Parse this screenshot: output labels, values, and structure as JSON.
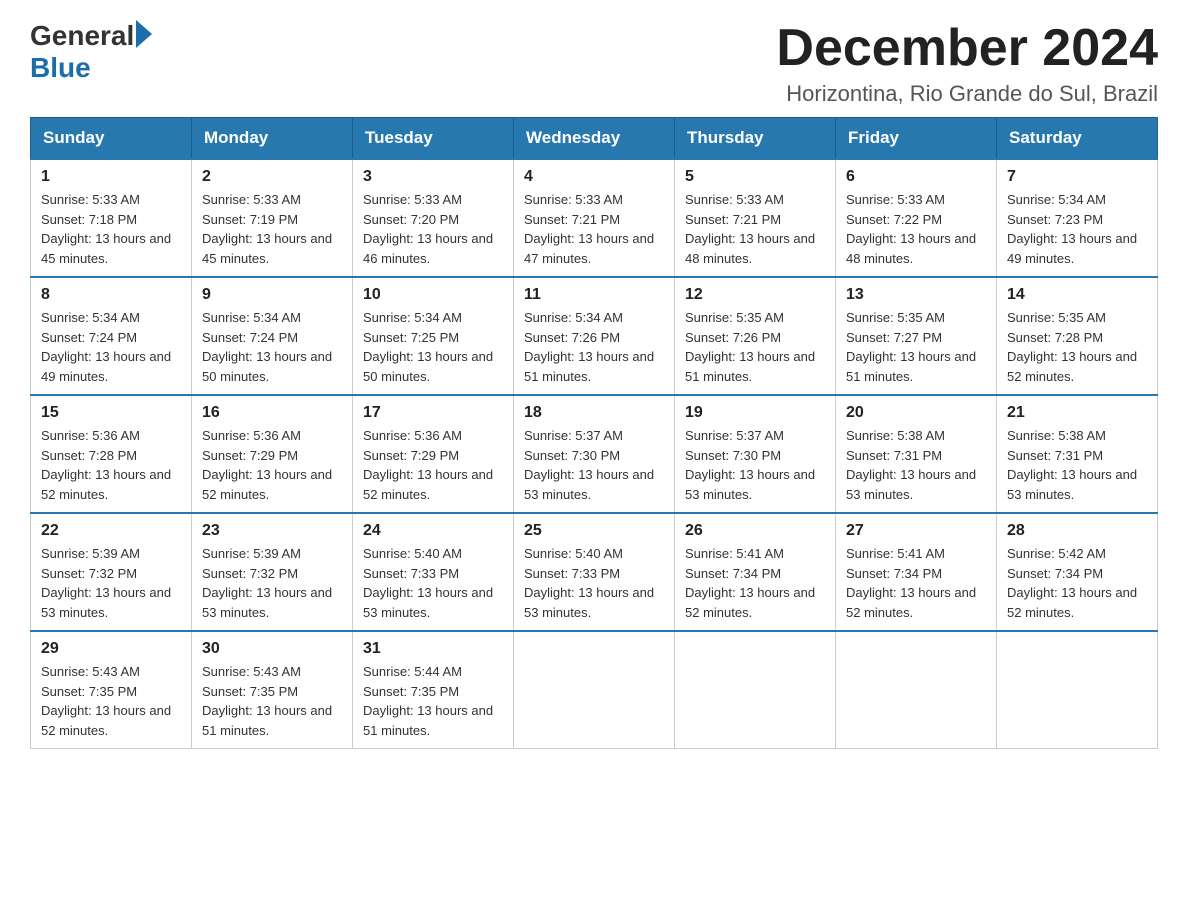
{
  "header": {
    "logo": {
      "general": "General",
      "blue": "Blue"
    },
    "title": "December 2024",
    "subtitle": "Horizontina, Rio Grande do Sul, Brazil"
  },
  "calendar": {
    "weekdays": [
      "Sunday",
      "Monday",
      "Tuesday",
      "Wednesday",
      "Thursday",
      "Friday",
      "Saturday"
    ],
    "weeks": [
      [
        {
          "day": "1",
          "sunrise": "5:33 AM",
          "sunset": "7:18 PM",
          "daylight": "13 hours and 45 minutes."
        },
        {
          "day": "2",
          "sunrise": "5:33 AM",
          "sunset": "7:19 PM",
          "daylight": "13 hours and 45 minutes."
        },
        {
          "day": "3",
          "sunrise": "5:33 AM",
          "sunset": "7:20 PM",
          "daylight": "13 hours and 46 minutes."
        },
        {
          "day": "4",
          "sunrise": "5:33 AM",
          "sunset": "7:21 PM",
          "daylight": "13 hours and 47 minutes."
        },
        {
          "day": "5",
          "sunrise": "5:33 AM",
          "sunset": "7:21 PM",
          "daylight": "13 hours and 48 minutes."
        },
        {
          "day": "6",
          "sunrise": "5:33 AM",
          "sunset": "7:22 PM",
          "daylight": "13 hours and 48 minutes."
        },
        {
          "day": "7",
          "sunrise": "5:34 AM",
          "sunset": "7:23 PM",
          "daylight": "13 hours and 49 minutes."
        }
      ],
      [
        {
          "day": "8",
          "sunrise": "5:34 AM",
          "sunset": "7:24 PM",
          "daylight": "13 hours and 49 minutes."
        },
        {
          "day": "9",
          "sunrise": "5:34 AM",
          "sunset": "7:24 PM",
          "daylight": "13 hours and 50 minutes."
        },
        {
          "day": "10",
          "sunrise": "5:34 AM",
          "sunset": "7:25 PM",
          "daylight": "13 hours and 50 minutes."
        },
        {
          "day": "11",
          "sunrise": "5:34 AM",
          "sunset": "7:26 PM",
          "daylight": "13 hours and 51 minutes."
        },
        {
          "day": "12",
          "sunrise": "5:35 AM",
          "sunset": "7:26 PM",
          "daylight": "13 hours and 51 minutes."
        },
        {
          "day": "13",
          "sunrise": "5:35 AM",
          "sunset": "7:27 PM",
          "daylight": "13 hours and 51 minutes."
        },
        {
          "day": "14",
          "sunrise": "5:35 AM",
          "sunset": "7:28 PM",
          "daylight": "13 hours and 52 minutes."
        }
      ],
      [
        {
          "day": "15",
          "sunrise": "5:36 AM",
          "sunset": "7:28 PM",
          "daylight": "13 hours and 52 minutes."
        },
        {
          "day": "16",
          "sunrise": "5:36 AM",
          "sunset": "7:29 PM",
          "daylight": "13 hours and 52 minutes."
        },
        {
          "day": "17",
          "sunrise": "5:36 AM",
          "sunset": "7:29 PM",
          "daylight": "13 hours and 52 minutes."
        },
        {
          "day": "18",
          "sunrise": "5:37 AM",
          "sunset": "7:30 PM",
          "daylight": "13 hours and 53 minutes."
        },
        {
          "day": "19",
          "sunrise": "5:37 AM",
          "sunset": "7:30 PM",
          "daylight": "13 hours and 53 minutes."
        },
        {
          "day": "20",
          "sunrise": "5:38 AM",
          "sunset": "7:31 PM",
          "daylight": "13 hours and 53 minutes."
        },
        {
          "day": "21",
          "sunrise": "5:38 AM",
          "sunset": "7:31 PM",
          "daylight": "13 hours and 53 minutes."
        }
      ],
      [
        {
          "day": "22",
          "sunrise": "5:39 AM",
          "sunset": "7:32 PM",
          "daylight": "13 hours and 53 minutes."
        },
        {
          "day": "23",
          "sunrise": "5:39 AM",
          "sunset": "7:32 PM",
          "daylight": "13 hours and 53 minutes."
        },
        {
          "day": "24",
          "sunrise": "5:40 AM",
          "sunset": "7:33 PM",
          "daylight": "13 hours and 53 minutes."
        },
        {
          "day": "25",
          "sunrise": "5:40 AM",
          "sunset": "7:33 PM",
          "daylight": "13 hours and 53 minutes."
        },
        {
          "day": "26",
          "sunrise": "5:41 AM",
          "sunset": "7:34 PM",
          "daylight": "13 hours and 52 minutes."
        },
        {
          "day": "27",
          "sunrise": "5:41 AM",
          "sunset": "7:34 PM",
          "daylight": "13 hours and 52 minutes."
        },
        {
          "day": "28",
          "sunrise": "5:42 AM",
          "sunset": "7:34 PM",
          "daylight": "13 hours and 52 minutes."
        }
      ],
      [
        {
          "day": "29",
          "sunrise": "5:43 AM",
          "sunset": "7:35 PM",
          "daylight": "13 hours and 52 minutes."
        },
        {
          "day": "30",
          "sunrise": "5:43 AM",
          "sunset": "7:35 PM",
          "daylight": "13 hours and 51 minutes."
        },
        {
          "day": "31",
          "sunrise": "5:44 AM",
          "sunset": "7:35 PM",
          "daylight": "13 hours and 51 minutes."
        },
        null,
        null,
        null,
        null
      ]
    ]
  }
}
